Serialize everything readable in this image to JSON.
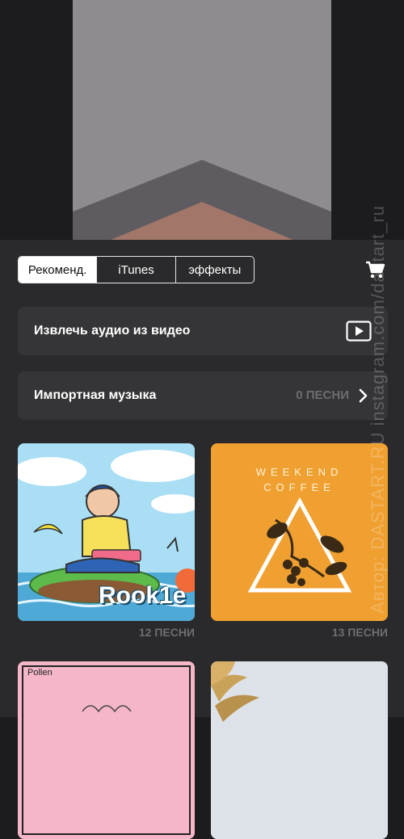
{
  "tabs": [
    "Рекоменд.",
    "iTunes",
    "эффекты"
  ],
  "extract_audio": {
    "label": "Извлечь аудио из видео"
  },
  "imported_music": {
    "label": "Импортная музыка",
    "count": "0 ПЕСНИ"
  },
  "albums": [
    {
      "name": "Rook1e",
      "count": "12 ПЕСНИ"
    },
    {
      "name": "WEEKEND COFFEE",
      "line1": "WEEKEND",
      "line2": "COFFEE",
      "count": "13 ПЕСНИ"
    },
    {
      "name": "Pollen"
    },
    {
      "name": ""
    }
  ],
  "watermark": "Автор: DASTART.RU   instagram.com/dastart_ru",
  "colors": {
    "accent_orange": "#f0a030",
    "pink": "#f5b6c9"
  }
}
